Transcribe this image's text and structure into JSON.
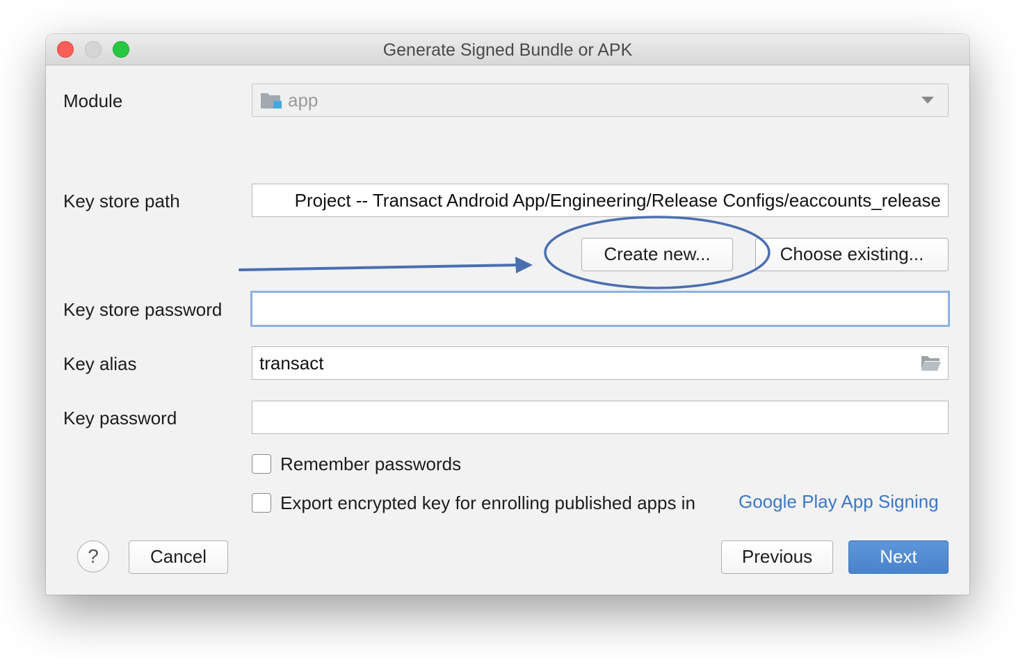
{
  "window": {
    "title": "Generate Signed Bundle or APK"
  },
  "module": {
    "label": "Module",
    "value": "app"
  },
  "key_store_path": {
    "label": "Key store path",
    "value": "Project -- Transact Android App/Engineering/Release Configs/eaccounts_release"
  },
  "buttons": {
    "create_new": "Create new...",
    "choose_existing": "Choose existing...",
    "cancel": "Cancel",
    "previous": "Previous",
    "next": "Next",
    "help": "?"
  },
  "key_store_password": {
    "label": "Key store password",
    "value": ""
  },
  "key_alias": {
    "label": "Key alias",
    "value": "transact"
  },
  "key_password": {
    "label": "Key password",
    "value": ""
  },
  "options": {
    "remember_passwords": "Remember passwords",
    "export_encrypted": "Export encrypted key for enrolling published apps in",
    "google_play_link": "Google Play App Signing"
  },
  "colors": {
    "accent": "#4a83cc",
    "annotation": "#4a6fb0",
    "link": "#3b78c6"
  }
}
